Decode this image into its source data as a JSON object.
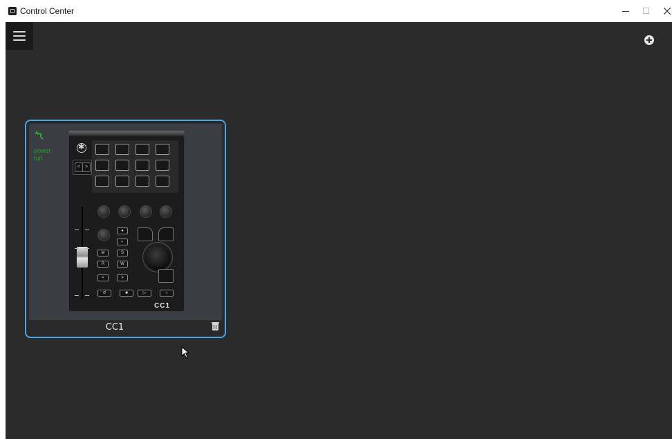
{
  "window": {
    "title": "Control Center",
    "controls": {
      "minimize_icon": "–",
      "maximize_icon": "☐",
      "close_icon": "✕"
    }
  },
  "toolbar": {
    "menu_icon": "hamburger-icon",
    "add_icon": "plus-circle-icon"
  },
  "device_card": {
    "name": "CC1",
    "status_line1": "power",
    "status_line2": "full",
    "device_logo": "CC1",
    "selected": true,
    "accent_color": "#43a9ea",
    "status_color": "#27a327"
  }
}
